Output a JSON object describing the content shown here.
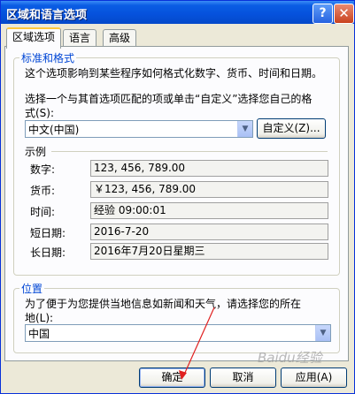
{
  "window": {
    "title": "区域和语言选项",
    "help_glyph": "?",
    "close_glyph": "✕"
  },
  "tabs": [
    {
      "label": "区域选项"
    },
    {
      "label": "语言"
    },
    {
      "label": "高级"
    }
  ],
  "standards": {
    "title": "标准和格式",
    "description": "这个选项影响到某些程序如何格式化数字、货币、时间和日期。",
    "instruction_line1": "选择一个与其首选项匹配的项或单击“自定义”选择您自己的格",
    "instruction_line2": "式(S):",
    "selected_locale": "中文(中国)",
    "customize_button": "自定义(Z)...",
    "samples_heading": "示例",
    "samples": [
      {
        "label": "数字:",
        "value": "123, 456, 789.00"
      },
      {
        "label": "货币:",
        "value": "￥123, 456, 789.00"
      },
      {
        "label": "时间:",
        "value": "经验 09:00:01"
      },
      {
        "label": "短日期:",
        "value": "2016-7-20"
      },
      {
        "label": "长日期:",
        "value": "2016年7月20日星期三"
      }
    ]
  },
  "location": {
    "title": "位置",
    "instruction_line1": "为了便于为您提供当地信息如新闻和天气，请选择您的所在",
    "instruction_line2": "地(L):",
    "selected": "中国"
  },
  "buttons": {
    "ok": "确定",
    "cancel": "取消",
    "apply": "应用(A)"
  },
  "watermark": "Baidu经验",
  "colors": {
    "titlebar": "#0551DC",
    "group_title": "#0046D5",
    "annotation": "#E02020",
    "dialog_bg": "#ECE9D8"
  }
}
